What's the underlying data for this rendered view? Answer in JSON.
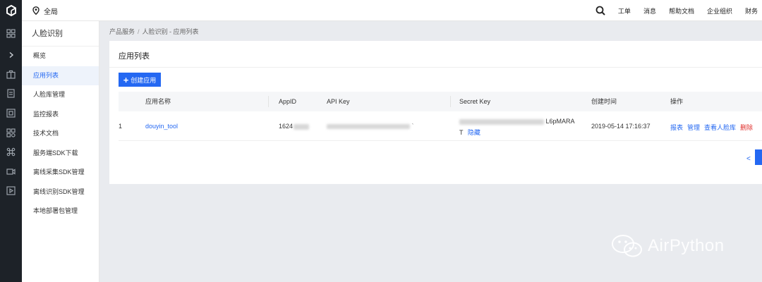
{
  "topbar": {
    "region": "全局",
    "nav": [
      "工单",
      "消息",
      "帮助文档",
      "企业组织",
      "财务"
    ]
  },
  "rail_icons": [
    "grid-icon",
    "chevron-right-icon",
    "briefcase-icon",
    "document-icon",
    "server-icon",
    "apps-icon",
    "command-icon",
    "video-icon",
    "play-icon"
  ],
  "sidebar": {
    "title": "人脸识别",
    "items": [
      {
        "label": "概览"
      },
      {
        "label": "应用列表",
        "active": true
      },
      {
        "label": "人脸库管理"
      },
      {
        "label": "监控报表"
      },
      {
        "label": "技术文档"
      },
      {
        "label": "服务端SDK下载"
      },
      {
        "label": "离线采集SDK管理"
      },
      {
        "label": "离线识别SDK管理"
      },
      {
        "label": "本地部署包管理"
      }
    ]
  },
  "breadcrumb": {
    "root": "产品服务",
    "separator": "/",
    "current": "人脸识别 - 应用列表"
  },
  "card": {
    "title": "应用列表",
    "create_button": "创建应用"
  },
  "table": {
    "headers": {
      "name": "应用名称",
      "appid": "AppID",
      "apikey": "API Key",
      "secret": "Secret Key",
      "created": "创建时间",
      "ops": "操作"
    },
    "rows": [
      {
        "index": "1",
        "name": "douyin_tool",
        "appid": "1624",
        "apikey_tail": "`",
        "secret_tail": "L6pMARA",
        "secret_line2": "T",
        "hide": "隐藏",
        "created": "2019-05-14 17:16:37",
        "ops": [
          "报表",
          "管理",
          "查看人脸库",
          "删除"
        ]
      }
    ]
  },
  "pager": {
    "prev": "<"
  },
  "watermark": "AirPython",
  "colors": {
    "accent": "#2468f2",
    "danger": "#e0312e",
    "rail": "#1d2228"
  }
}
